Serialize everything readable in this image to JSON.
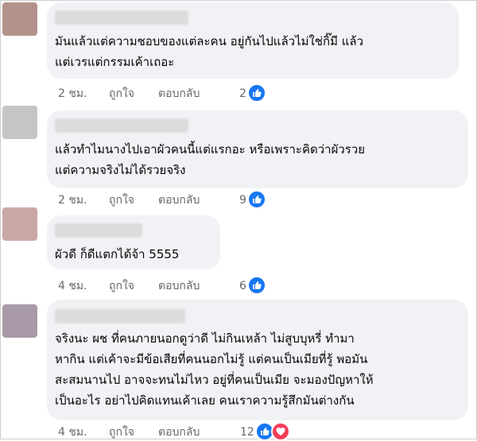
{
  "comments": [
    {
      "lines": [
        "มันแล้วแต่ความชอบของแต่ละคน อยู่กันไปแล้วไม่ใช่กิ๊มี แล้ว",
        "แต่เวรแต่กรรมเค้าเถอะ"
      ],
      "time": "2 ชม.",
      "like_label": "ถูกใจ",
      "reply_label": "ตอบกลับ",
      "reaction_count": "2",
      "reactions": [
        "like-icon"
      ],
      "avatar_color": "#b3928c"
    },
    {
      "lines": [
        "แล้วทำไมนางไปเอาผัวคนนี้แต่แรกอะ หรือเพราะคิดว่าผัวรวย",
        "แต่ความจริงไม่ได้รวยจริง"
      ],
      "time": "2 ชม.",
      "like_label": "ถูกใจ",
      "reply_label": "ตอบกลับ",
      "reaction_count": "9",
      "reactions": [
        "like-icon"
      ],
      "avatar_color": "#c5c5c8"
    },
    {
      "lines": [
        "ผัวดี ก็ดีแตกได้จ้า 5555"
      ],
      "time": "4 ชม.",
      "like_label": "ถูกใจ",
      "reply_label": "ตอบกลับ",
      "reaction_count": "6",
      "reactions": [
        "like-icon"
      ],
      "avatar_color": "#c8a8a6"
    },
    {
      "lines": [
        "จริงนะ ผช ที่คนภายนอกดูว่าดี ไม่กินเหล้า ไม่สูบบุหรี่ ทำมา",
        "หากิน แต่เค้าจะมีข้อเสียที่คนนอกไม่รู้ แต่คนเป็นเมียที่รู้ พอมัน",
        "สะสมนานไป อาจจะทนไม่ไหว อยู่ที่คนเป็นเมีย จะมองปัญหาให้",
        "เป็นอะไร อย่าไปคิดแทนเค้าเลย คนเราความรู้สึกมันต่างกัน"
      ],
      "time": "4 ชม.",
      "like_label": "ถูกใจ",
      "reply_label": "ตอบกลับ",
      "reaction_count": "12",
      "reactions": [
        "like-icon",
        "love-icon"
      ],
      "avatar_color": "#a89aa8"
    }
  ],
  "colors": {
    "bubble": "#f0f2f5",
    "like": "#1877f2",
    "love": "#f33e58",
    "meta": "#65676b"
  }
}
